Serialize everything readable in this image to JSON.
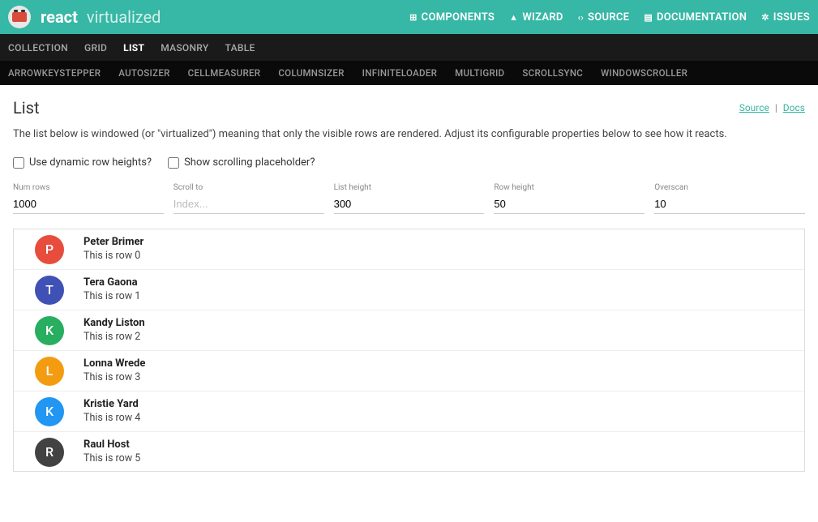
{
  "header": {
    "brand_bold": "react",
    "brand_light": "virtualized",
    "nav": [
      {
        "icon": "grid-icon",
        "glyph": "⊞",
        "label": "COMPONENTS"
      },
      {
        "icon": "wizard-icon",
        "glyph": "▲",
        "label": "WIZARD"
      },
      {
        "icon": "source-icon",
        "glyph": "‹›",
        "label": "SOURCE"
      },
      {
        "icon": "documentation-icon",
        "glyph": "▤",
        "label": "DOCUMENTATION"
      },
      {
        "icon": "issues-icon",
        "glyph": "✲",
        "label": "ISSUES"
      }
    ]
  },
  "subnav1": {
    "items": [
      "COLLECTION",
      "GRID",
      "LIST",
      "MASONRY",
      "TABLE"
    ],
    "active": "LIST"
  },
  "subnav2": {
    "items": [
      "ARROWKEYSTEPPER",
      "AUTOSIZER",
      "CELLMEASURER",
      "COLUMNSIZER",
      "INFINITELOADER",
      "MULTIGRID",
      "SCROLLSYNC",
      "WINDOWSCROLLER"
    ]
  },
  "page": {
    "title": "List",
    "source_link": "Source",
    "docs_link": "Docs",
    "description": "The list below is windowed (or \"virtualized\") meaning that only the visible rows are rendered. Adjust its configurable properties below to see how it reacts."
  },
  "checks": {
    "dynamic_label": "Use dynamic row heights?",
    "placeholder_label": "Show scrolling placeholder?"
  },
  "inputs": {
    "num_rows": {
      "label": "Num rows",
      "value": "1000"
    },
    "scroll_to": {
      "label": "Scroll to",
      "placeholder": "Index..."
    },
    "list_height": {
      "label": "List height",
      "value": "300"
    },
    "row_height": {
      "label": "Row height",
      "value": "50"
    },
    "overscan": {
      "label": "Overscan",
      "value": "10"
    }
  },
  "rows": [
    {
      "letter": "P",
      "color": "#e74c3c",
      "name": "Peter Brimer",
      "sub": "This is row 0"
    },
    {
      "letter": "T",
      "color": "#3f51b5",
      "name": "Tera Gaona",
      "sub": "This is row 1"
    },
    {
      "letter": "K",
      "color": "#27ae60",
      "name": "Kandy Liston",
      "sub": "This is row 2"
    },
    {
      "letter": "L",
      "color": "#f39c12",
      "name": "Lonna Wrede",
      "sub": "This is row 3"
    },
    {
      "letter": "K",
      "color": "#2196f3",
      "name": "Kristie Yard",
      "sub": "This is row 4"
    },
    {
      "letter": "R",
      "color": "#424242",
      "name": "Raul Host",
      "sub": "This is row 5"
    }
  ]
}
